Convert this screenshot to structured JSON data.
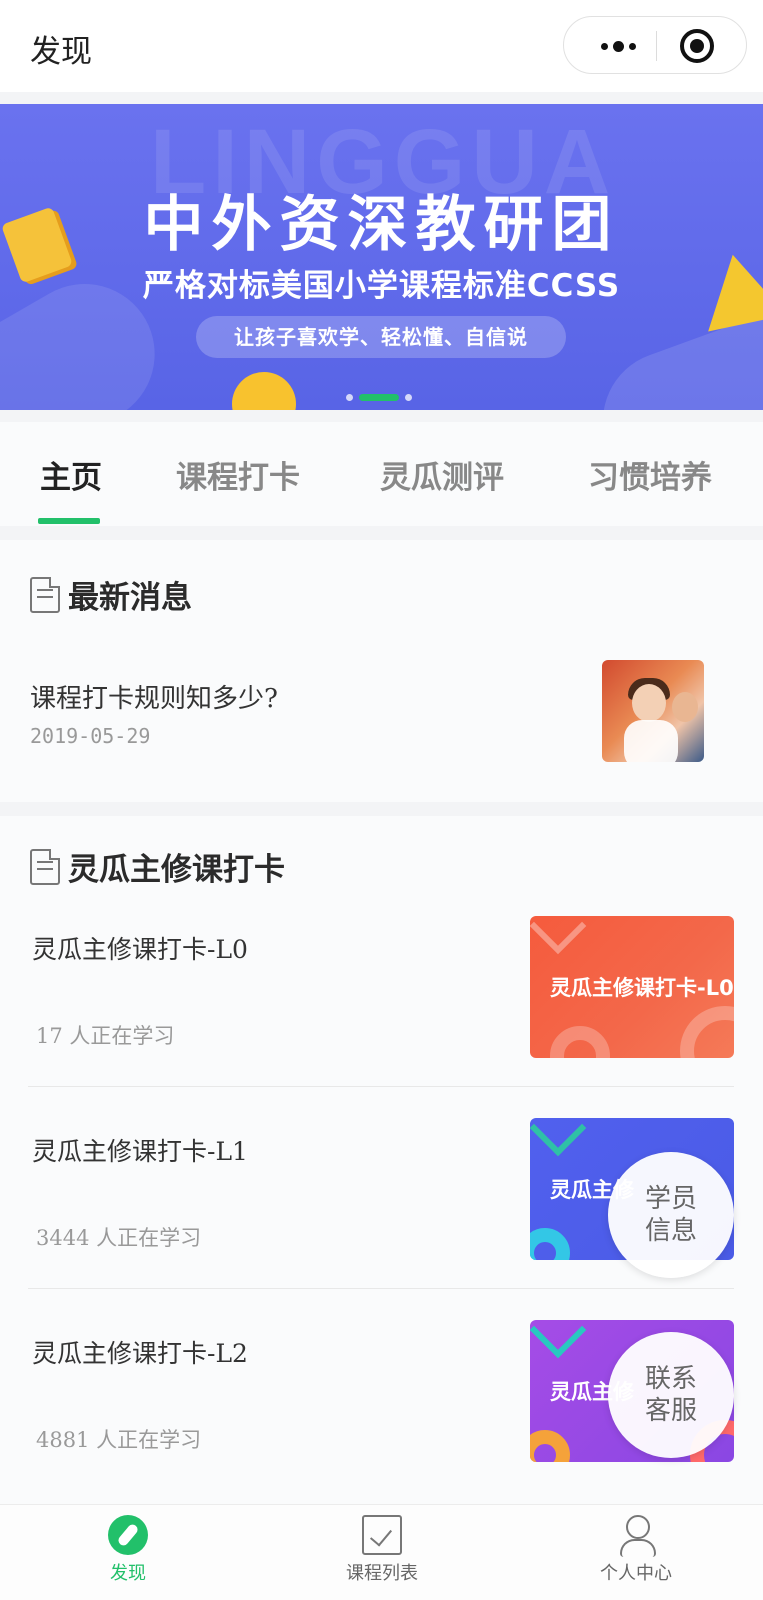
{
  "navbar": {
    "title": "发现"
  },
  "banner": {
    "bg_text": "LINGGUA",
    "title": "中外资深教研团",
    "subtitle": "严格对标美国小学课程标准CCSS",
    "pill": "让孩子喜欢学、轻松懂、自信说",
    "active_slide": 2,
    "slide_count": 3
  },
  "tabs": {
    "items": [
      {
        "label": "主页"
      },
      {
        "label": "课程打卡"
      },
      {
        "label": "灵瓜测评"
      },
      {
        "label": "习惯培养"
      }
    ],
    "active_index": 0,
    "accent": "#22c06a"
  },
  "news": {
    "section_title": "最新消息",
    "items": [
      {
        "title": "课程打卡规则知多少?",
        "date": "2019-05-29"
      }
    ]
  },
  "courses": {
    "section_title": "灵瓜主修课打卡",
    "items": [
      {
        "title": "灵瓜主修课打卡-L0",
        "count": "17 人正在学习",
        "thumb_text": "灵瓜主修课打卡-L0",
        "thumb_color": "#f55b3d"
      },
      {
        "title": "灵瓜主修课打卡-L1",
        "count": "3444 人正在学习",
        "thumb_text": "灵瓜主修",
        "thumb_color": "#5160ee"
      },
      {
        "title": "灵瓜主修课打卡-L2",
        "count": "4881 人正在学习",
        "thumb_text": "灵瓜主修",
        "thumb_color": "#a54ce6"
      }
    ]
  },
  "floating": {
    "student_info": "学员信息",
    "contact_service": "联系客服"
  },
  "tabbar": {
    "items": [
      {
        "label": "发现",
        "icon": "compass-icon"
      },
      {
        "label": "课程列表",
        "icon": "checklist-icon"
      },
      {
        "label": "个人中心",
        "icon": "user-icon"
      }
    ],
    "active_index": 0
  }
}
